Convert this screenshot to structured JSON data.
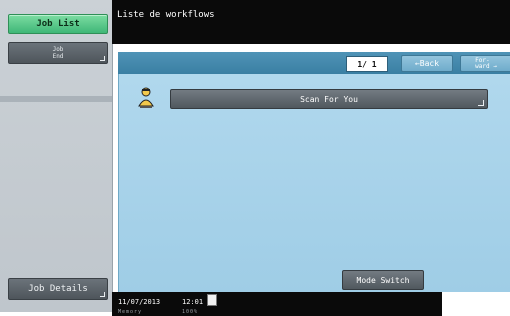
{
  "sidebar": {
    "job_list_label": "Job List",
    "job_end_label": "Job\nEnd",
    "job_details_label": "Job Details"
  },
  "header": {
    "title": "Liste de workflows"
  },
  "toolbar": {
    "page_indicator": "1/ 1",
    "back_label": "←Back",
    "forward_label": "For-\nward →"
  },
  "main": {
    "workflow_button_label": "Scan For You",
    "workflow_icon": "person-icon",
    "mode_switch_label": "Mode Switch"
  },
  "footer": {
    "date": "11/07/2013",
    "time": "12:01",
    "memory_label": "Memory",
    "memory_value": "100%"
  },
  "colors": {
    "accent_green": "#3fb777",
    "panel_blue": "#a9d3ea",
    "bar_blue": "#3f86ab",
    "button_gray": "#5f676d",
    "header_black": "#0a0a0a"
  }
}
